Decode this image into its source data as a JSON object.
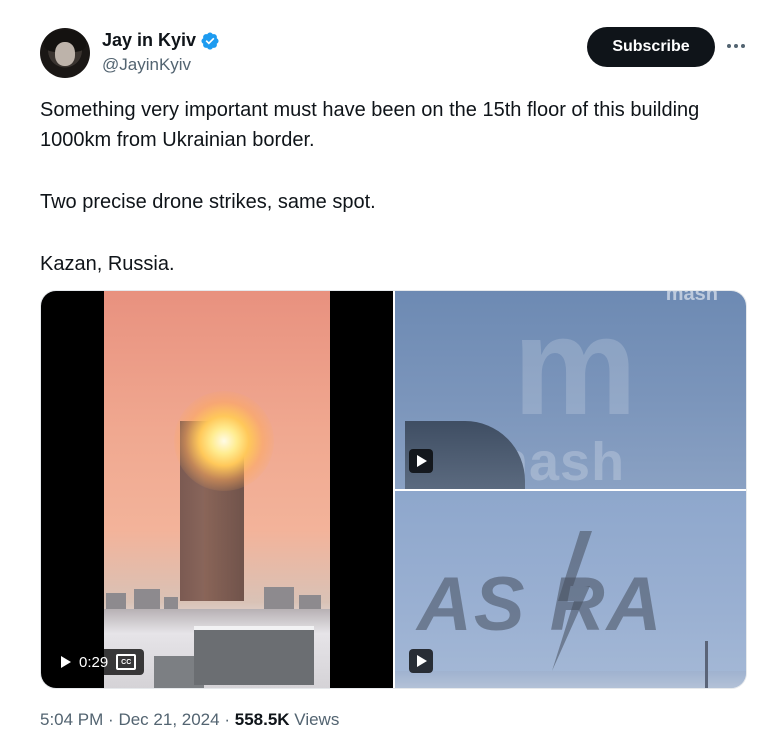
{
  "author": {
    "display_name": "Jay in Kyiv",
    "handle": "@JayinKyiv",
    "verified": true,
    "verified_badge_color": "#1d9bf0"
  },
  "actions": {
    "subscribe_label": "Subscribe",
    "more_icon": "more-horizontal-icon"
  },
  "tweet": {
    "paragraphs": [
      "Something very important must have been on the 15th floor of this building 1000km from Ukrainian border.",
      "Two precise drone strikes, same spot.",
      "Kazan, Russia."
    ]
  },
  "media": {
    "video_main": {
      "duration": "0:29",
      "captions_icon": "closed-captions-icon",
      "cc_label": "CC"
    },
    "video_top_right": {
      "watermark_big": "m",
      "watermark_text": "mash",
      "watermark_small": "mash"
    },
    "video_bottom_right": {
      "watermark_text": "AS RA"
    }
  },
  "meta": {
    "time": "5:04 PM",
    "separator": "·",
    "date": "Dec 21, 2024",
    "views_count": "558.5K",
    "views_label": "Views"
  }
}
